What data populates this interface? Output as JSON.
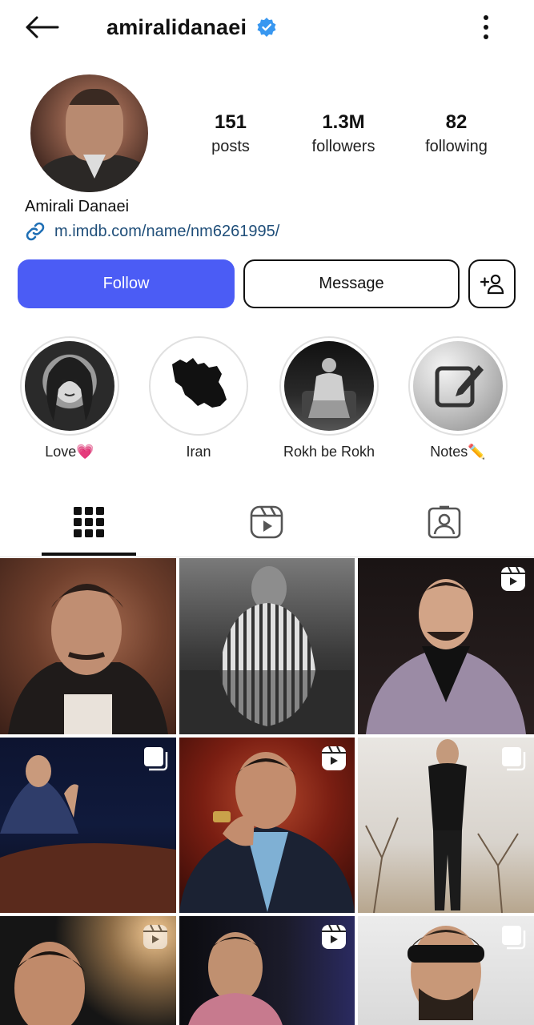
{
  "header": {
    "username": "amiralidanaei",
    "verified": true,
    "back_icon": "arrow-left-icon",
    "menu_icon": "more-vertical-icon"
  },
  "profile": {
    "stats": {
      "posts": {
        "value": "151",
        "label": "posts"
      },
      "followers": {
        "value": "1.3M",
        "label": "followers"
      },
      "following": {
        "value": "82",
        "label": "following"
      }
    },
    "full_name": "Amirali Danaei",
    "website": "m.imdb.com/name/nm6261995/"
  },
  "actions": {
    "follow_label": "Follow",
    "message_label": "Message",
    "add_user_icon": "add-user-icon"
  },
  "highlights": [
    {
      "label": "Love💗"
    },
    {
      "label": "Iran"
    },
    {
      "label": "Rokh be Rokh"
    },
    {
      "label": "Notes✏️"
    }
  ],
  "tabs": [
    {
      "name": "posts-grid",
      "icon": "grid-icon",
      "active": true
    },
    {
      "name": "reels",
      "icon": "reels-icon",
      "active": false
    },
    {
      "name": "tagged",
      "icon": "tagged-user-icon",
      "active": false
    }
  ],
  "grid": [
    {
      "type": "photo"
    },
    {
      "type": "photo"
    },
    {
      "type": "reel"
    },
    {
      "type": "carousel"
    },
    {
      "type": "reel"
    },
    {
      "type": "carousel"
    },
    {
      "type": "reel"
    },
    {
      "type": "reel"
    },
    {
      "type": "carousel"
    }
  ],
  "colors": {
    "accent": "#4b5cf5",
    "verified": "#3897f0",
    "link": "#1f4e79"
  }
}
